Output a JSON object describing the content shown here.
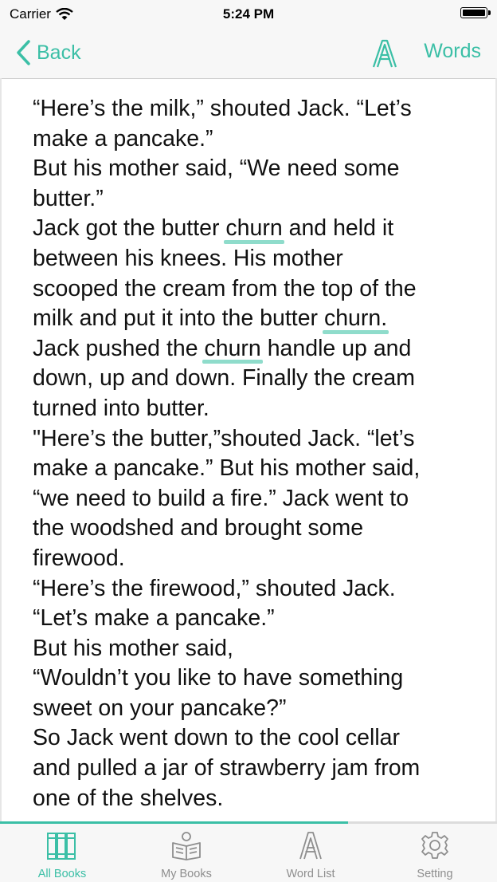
{
  "status_bar": {
    "carrier": "Carrier",
    "time": "5:24 PM"
  },
  "nav": {
    "back_label": "Back",
    "words_label": "Words",
    "font_icon": "font-size-icon"
  },
  "colors": {
    "accent": "#3bbfa6",
    "highlight": "#8fdccb"
  },
  "story": {
    "highlighted_word": "churn",
    "lines": [
      [
        {
          "t": "“Here’s the milk,” shouted Jack. “Let’s"
        }
      ],
      [
        {
          "t": "make a pancake.”"
        }
      ],
      [
        {
          "t": "But his mother said, “We need some"
        }
      ],
      [
        {
          "t": "butter.”"
        }
      ],
      [
        {
          "t": "Jack got the butter "
        },
        {
          "t": "churn",
          "hl": true
        },
        {
          "t": " and held it"
        }
      ],
      [
        {
          "t": "between his knees. His mother"
        }
      ],
      [
        {
          "t": "scooped the cream from the top of the"
        }
      ],
      [
        {
          "t": "milk and put it into the butter "
        },
        {
          "t": "churn.",
          "hl": true
        }
      ],
      [
        {
          "t": "Jack pushed the "
        },
        {
          "t": "churn",
          "hl": true
        },
        {
          "t": " handle up and"
        }
      ],
      [
        {
          "t": "down, up and down. Finally the cream"
        }
      ],
      [
        {
          "t": "turned into butter."
        }
      ],
      [
        {
          "t": "\"Here’s the butter,”shouted Jack. “let’s"
        }
      ],
      [
        {
          "t": "make a pancake.” But his mother said,"
        }
      ],
      [
        {
          "t": "“we need to build a fire.” Jack went to"
        }
      ],
      [
        {
          "t": "the woodshed and brought some"
        }
      ],
      [
        {
          "t": "firewood."
        }
      ],
      [
        {
          "t": "“Here’s the firewood,” shouted Jack."
        }
      ],
      [
        {
          "t": "“Let’s make a pancake.”"
        }
      ],
      [
        {
          "t": "But his mother said,"
        }
      ],
      [
        {
          "t": "“Wouldn’t you like to have something"
        }
      ],
      [
        {
          "t": "sweet on your pancake?”"
        }
      ],
      [
        {
          "t": "So Jack went down to the cool cellar"
        }
      ],
      [
        {
          "t": "and pulled a jar of strawberry jam from"
        }
      ],
      [
        {
          "t": "one of the shelves."
        }
      ]
    ]
  },
  "reading_progress": 0.7,
  "tabs": [
    {
      "label": "All Books",
      "icon": "books-icon",
      "active": true
    },
    {
      "label": "My Books",
      "icon": "open-book-icon",
      "active": false
    },
    {
      "label": "Word List",
      "icon": "letter-a-icon",
      "active": false
    },
    {
      "label": "Setting",
      "icon": "gear-icon",
      "active": false
    }
  ]
}
